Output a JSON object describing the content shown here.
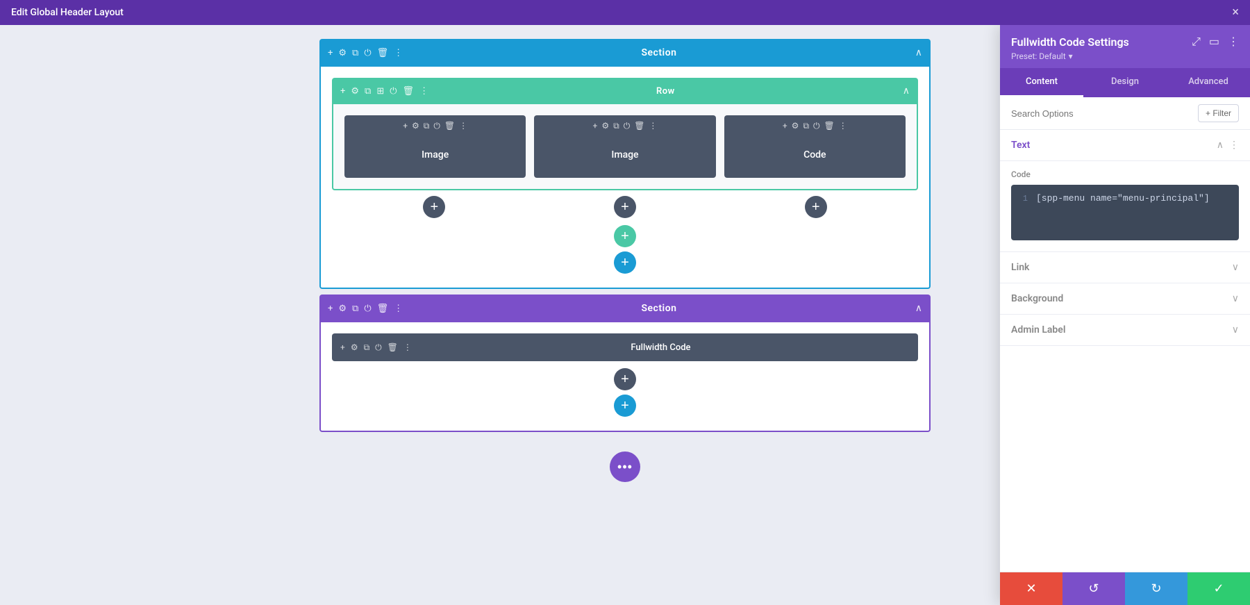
{
  "topbar": {
    "title": "Edit Global Header Layout",
    "close_label": "×"
  },
  "canvas": {
    "section1": {
      "label": "Section",
      "type": "blue",
      "row": {
        "label": "Row",
        "modules": [
          {
            "label": "Image"
          },
          {
            "label": "Image"
          },
          {
            "label": "Code"
          }
        ]
      }
    },
    "section2": {
      "label": "Section",
      "type": "purple",
      "fullwidth_bar": {
        "label": "Fullwidth Code"
      }
    },
    "three_dots_label": "•••"
  },
  "settings_panel": {
    "title": "Fullwidth Code Settings",
    "preset_label": "Preset: Default",
    "tabs": [
      {
        "label": "Content",
        "active": true
      },
      {
        "label": "Design",
        "active": false
      },
      {
        "label": "Advanced",
        "active": false
      }
    ],
    "search_placeholder": "Search Options",
    "filter_btn_label": "+ Filter",
    "sections": [
      {
        "title": "Text",
        "color": "purple",
        "expanded": true,
        "code_label": "Code",
        "code_value": "[spp-menu name=\"menu-principal\"]",
        "line_num": "1"
      },
      {
        "title": "Link",
        "color": "gray",
        "expanded": false
      },
      {
        "title": "Background",
        "color": "gray",
        "expanded": false
      },
      {
        "title": "Admin Label",
        "color": "gray",
        "expanded": false
      }
    ],
    "footer_buttons": [
      {
        "icon": "✕",
        "color": "red",
        "name": "cancel-button"
      },
      {
        "icon": "↺",
        "color": "purple",
        "name": "undo-button"
      },
      {
        "icon": "↻",
        "color": "blue",
        "name": "redo-button"
      },
      {
        "icon": "✓",
        "color": "green",
        "name": "save-button"
      }
    ]
  }
}
